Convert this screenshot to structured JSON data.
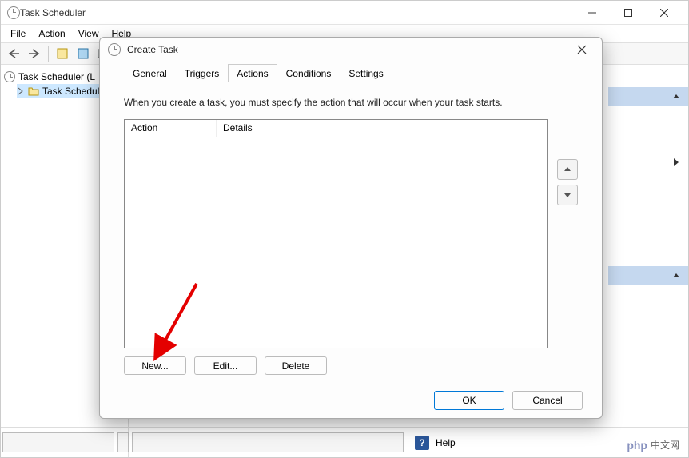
{
  "main": {
    "title": "Task Scheduler",
    "menu": [
      "File",
      "Action",
      "View",
      "Help"
    ],
    "tree": {
      "root": "Task Scheduler (L",
      "child": "Task Scheduler"
    },
    "status_help": "Help"
  },
  "dialog": {
    "title": "Create Task",
    "tabs": [
      "General",
      "Triggers",
      "Actions",
      "Conditions",
      "Settings"
    ],
    "active_tab": 2,
    "desc": "When you create a task, you must specify the action that will occur when your task starts.",
    "columns": {
      "action": "Action",
      "details": "Details"
    },
    "buttons": {
      "new": "New...",
      "edit": "Edit...",
      "delete": "Delete"
    },
    "footer": {
      "ok": "OK",
      "cancel": "Cancel"
    }
  },
  "watermark": {
    "brand": "php",
    "text": "中文网"
  }
}
